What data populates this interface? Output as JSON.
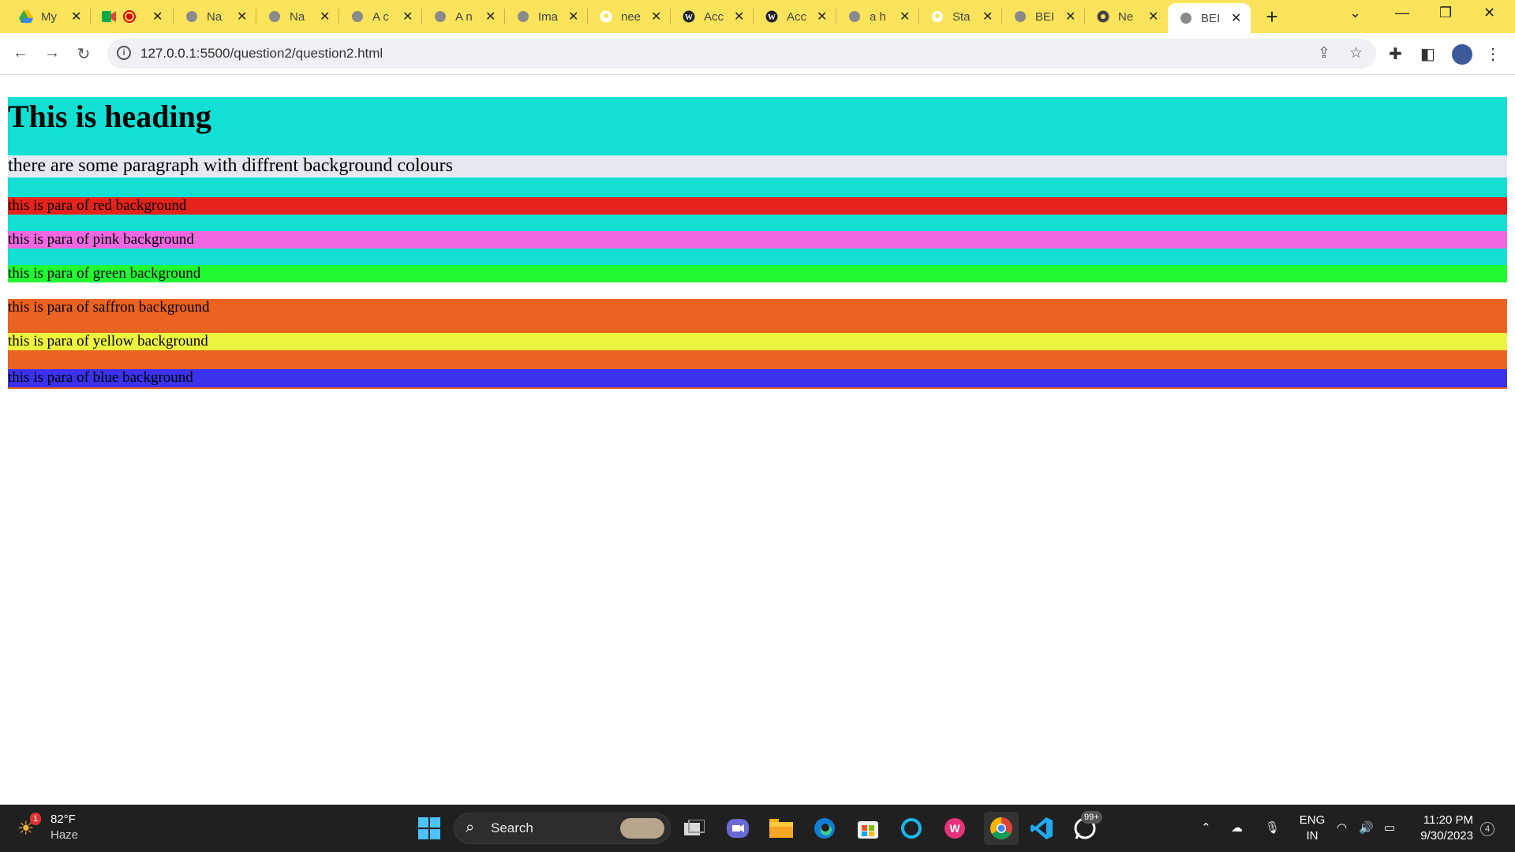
{
  "browser": {
    "tabs": [
      {
        "title": "My",
        "icon": "drive-icon"
      },
      {
        "title": "",
        "icon": "meet-icon"
      },
      {
        "title": "Na",
        "icon": "globe-icon"
      },
      {
        "title": "Na",
        "icon": "globe-icon"
      },
      {
        "title": "A c",
        "icon": "globe-icon"
      },
      {
        "title": "A n",
        "icon": "globe-icon"
      },
      {
        "title": "Ima",
        "icon": "globe-icon"
      },
      {
        "title": "nee",
        "icon": "github-icon"
      },
      {
        "title": "Acc",
        "icon": "wordpress-icon"
      },
      {
        "title": "Acc",
        "icon": "wordpress-icon"
      },
      {
        "title": "a h",
        "icon": "globe-icon"
      },
      {
        "title": "Sta",
        "icon": "github-icon"
      },
      {
        "title": "BEI",
        "icon": "globe-icon"
      },
      {
        "title": "Ne",
        "icon": "chrome-icon"
      },
      {
        "title": "BEI",
        "icon": "globe-icon"
      }
    ],
    "url_host": "127.0.0.1",
    "url_path": ":5500/question2/question2.html"
  },
  "page": {
    "heading": "This is heading",
    "subtitle": "there are some paragraph with diffrent background colours",
    "paras": [
      {
        "text": "this is para of red background",
        "color": "#e5231a"
      },
      {
        "text": "this is para of pink background",
        "color": "#ee67e1"
      },
      {
        "text": "this is para of green background",
        "color": "#21fb33"
      },
      {
        "text": "this is para of saffron background",
        "color": "#eb6320"
      },
      {
        "text": "this is para of yellow background",
        "color": "#eef33f"
      },
      {
        "text": "this is para of blue background",
        "color": "#3a32ee"
      }
    ],
    "colors": {
      "cyan": "#12e0d4",
      "saffron": "#eb6320",
      "subtitle_bg": "#e5e7f1"
    }
  },
  "taskbar": {
    "weather_temp": "82°F",
    "weather_desc": "Haze",
    "weather_badge": "1",
    "search_label": "Search",
    "whatsapp_badge": "99+",
    "lang_top": "ENG",
    "lang_bottom": "IN",
    "time": "11:20 PM",
    "date": "9/30/2023",
    "notif_count": "4"
  }
}
